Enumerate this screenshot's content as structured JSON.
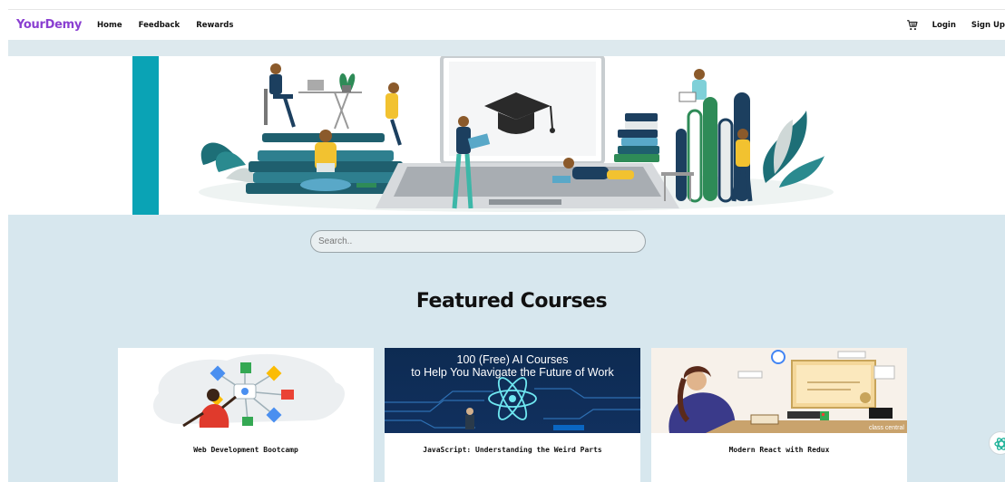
{
  "nav": {
    "brand": "YourDemy",
    "links": [
      "Home",
      "Feedback",
      "Rewards"
    ],
    "cart_icon": "cart-icon",
    "login": "Login",
    "signup": "Sign Up"
  },
  "hero": {
    "image": "online-learning-illustration"
  },
  "search": {
    "placeholder": "Search.."
  },
  "featured": {
    "title": "Featured Courses"
  },
  "courses": [
    {
      "title": "Web Development Bootcamp",
      "image": "web-development-illustration"
    },
    {
      "title": "JavaScript: Understanding the Weird Parts",
      "image": "ai-courses-banner",
      "banner_text": "100 (Free) AI Courses to Help You Navigate the Future of Work"
    },
    {
      "title": "Modern React with Redux",
      "image": "certificate-illustration",
      "banner_text": "class central"
    }
  ],
  "colors": {
    "brand": "#8a3fd1",
    "page_bg": "#d7e7ee",
    "teal_accent": "#0aa3b5"
  },
  "chat_fab": "chat-icon"
}
